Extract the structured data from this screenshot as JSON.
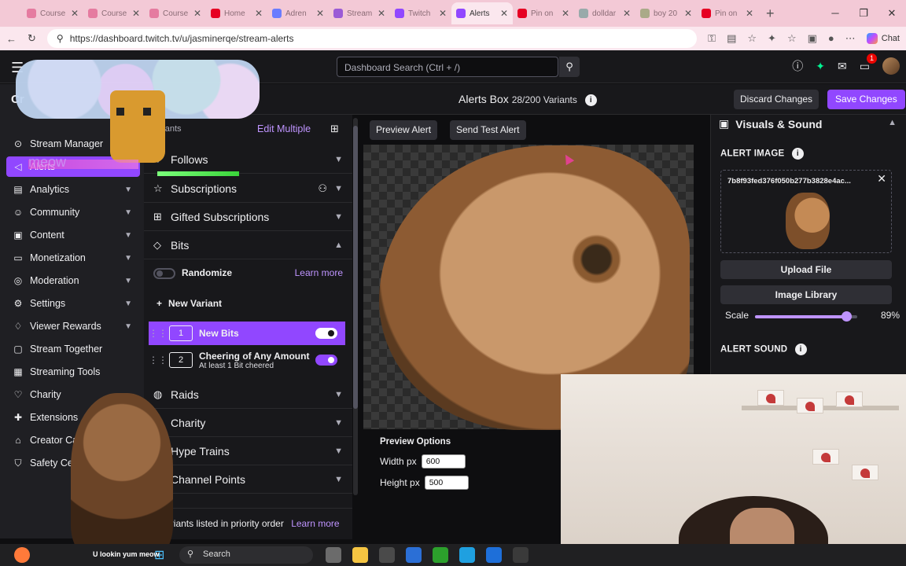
{
  "browser": {
    "tabs": [
      {
        "title": "Course",
        "color": "#e57ba0"
      },
      {
        "title": "Course",
        "color": "#e57ba0"
      },
      {
        "title": "Course",
        "color": "#e57ba0"
      },
      {
        "title": "Home",
        "color": "#e60023"
      },
      {
        "title": "Adren",
        "color": "#6a7cff"
      },
      {
        "title": "Stream",
        "color": "#9b5bd6"
      },
      {
        "title": "Twitch",
        "color": "#9147ff"
      },
      {
        "title": "Alerts",
        "color": "#9147ff"
      },
      {
        "title": "Pin on",
        "color": "#e60023"
      },
      {
        "title": "dolldar",
        "color": "#9aa"
      },
      {
        "title": "boy 20",
        "color": "#aa8"
      },
      {
        "title": "Pin on",
        "color": "#e60023"
      }
    ],
    "active_tab_index": 7,
    "url": "https://dashboard.twitch.tv/u/jasminerqe/stream-alerts",
    "chat_label": "Chat"
  },
  "topbar": {
    "search_placeholder": "Dashboard Search (Ctrl + /)",
    "notification_count": "1"
  },
  "sidebar": {
    "title": "Cr",
    "items": [
      {
        "label": "Stream Manager",
        "icon": "stream-manager-icon",
        "glyph": "⊙",
        "chev": false
      },
      {
        "label": "Alerts",
        "icon": "alerts-icon",
        "glyph": "◁",
        "chev": false,
        "selected": true
      },
      {
        "label": "Analytics",
        "icon": "analytics-icon",
        "glyph": "▤",
        "chev": true
      },
      {
        "label": "Community",
        "icon": "community-icon",
        "glyph": "☺",
        "chev": true
      },
      {
        "label": "Content",
        "icon": "content-icon",
        "glyph": "▣",
        "chev": true
      },
      {
        "label": "Monetization",
        "icon": "monetization-icon",
        "glyph": "▭",
        "chev": true
      },
      {
        "label": "Moderation",
        "icon": "moderation-icon",
        "glyph": "◎",
        "chev": true
      },
      {
        "label": "Settings",
        "icon": "settings-icon",
        "glyph": "⚙",
        "chev": true
      },
      {
        "label": "Viewer Rewards",
        "icon": "viewer-rewards-icon",
        "glyph": "♢",
        "chev": true
      },
      {
        "label": "Stream Together",
        "icon": "stream-together-icon",
        "glyph": "▢",
        "chev": false
      },
      {
        "label": "Streaming Tools",
        "icon": "streaming-tools-icon",
        "glyph": "▦",
        "chev": false
      },
      {
        "label": "Charity",
        "icon": "charity-icon",
        "glyph": "♡",
        "chev": false
      },
      {
        "label": "Extensions",
        "icon": "extensions-icon",
        "glyph": "✚",
        "chev": false
      },
      {
        "label": "Creator Cam",
        "icon": "creator-camp-icon",
        "glyph": "⌂",
        "chev": false
      },
      {
        "label": "Safety Cer",
        "icon": "safety-center-icon",
        "glyph": "⛉",
        "chev": false
      }
    ]
  },
  "header": {
    "title": "Alerts Box",
    "variant_count": "28/200 Variants",
    "discard_label": "Discard Changes",
    "save_label": "Save Changes"
  },
  "variants_panel": {
    "label": "Variants",
    "edit_multiple": "Edit Multiple",
    "sections": [
      {
        "label": "Follows",
        "icon": "heart-icon",
        "glyph": "♡",
        "open": false
      },
      {
        "label": "Subscriptions",
        "icon": "star-icon",
        "glyph": "☆",
        "open": false
      },
      {
        "label": "Gifted Subscriptions",
        "icon": "gift-icon",
        "glyph": "⊞",
        "open": false
      },
      {
        "label": "Bits",
        "icon": "bits-icon",
        "glyph": "◇",
        "open": true
      }
    ],
    "randomize_label": "Randomize",
    "learn_more": "Learn more",
    "new_variant": "New Variant",
    "variants": [
      {
        "num": "1",
        "title": "New Bits",
        "sub": "",
        "active": true
      },
      {
        "num": "2",
        "title": "Cheering of Any Amount",
        "sub": "At least 1 Bit cheered",
        "active": false
      }
    ],
    "lower_sections": [
      {
        "label": "Raids",
        "icon": "raid-icon",
        "glyph": "◍"
      },
      {
        "label": "Charity",
        "icon": "charity-heart-icon",
        "glyph": "♡"
      },
      {
        "label": "Hype Trains",
        "icon": "train-icon",
        "glyph": "▥"
      },
      {
        "label": "Channel Points",
        "icon": "channel-points-icon",
        "glyph": "◌"
      }
    ],
    "footer_text": "Variants listed in priority order",
    "footer_link": "Learn more"
  },
  "preview": {
    "preview_alert": "Preview Alert",
    "send_test_alert": "Send Test Alert",
    "options_title": "Preview Options",
    "width_label": "Width px",
    "width_value": "600",
    "height_label": "Height px",
    "height_value": "500"
  },
  "right_panel": {
    "section_title": "Visuals & Sound",
    "alert_image_label": "ALERT IMAGE",
    "image_filename": "7b8f93fed376f050b277b3828e4ac...",
    "upload_file": "Upload File",
    "image_library": "Image Library",
    "scale_label": "Scale",
    "scale_value": "89%",
    "scale_fraction": 0.89,
    "alert_sound_label": "ALERT SOUND"
  },
  "overlay": {
    "meow_text": "meow",
    "cat_caption": "U lookin yum meow"
  },
  "taskbar": {
    "search_label": "Search"
  }
}
